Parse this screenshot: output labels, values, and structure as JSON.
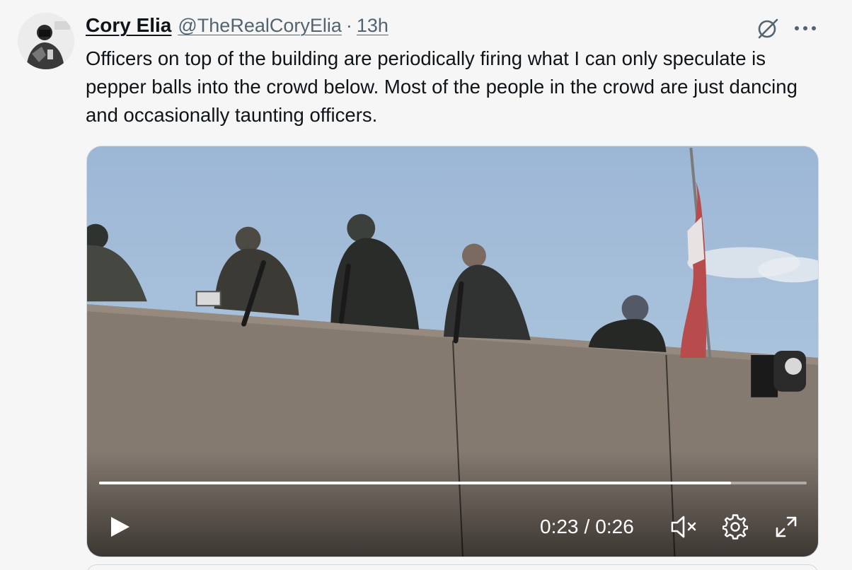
{
  "tweet": {
    "author_name": "Cory Elia",
    "handle": "@TheRealCoryElia",
    "separator": "·",
    "time": "13h",
    "text": "Officers on top of the building are periodically firing what I can only speculate is pepper balls into the crowd below. Most of the people in the crowd are just dancing and occasionally taunting officers.",
    "avatar_icon": "profile-photo"
  },
  "actions": {
    "grok_icon": "grok-icon",
    "more_icon": "more-horizontal-icon"
  },
  "video": {
    "current_time": "0:23",
    "time_separator": "/",
    "duration": "0:26",
    "progress_fraction": 0.893,
    "muted": true,
    "icons": [
      "play-icon",
      "mute-icon",
      "settings-icon",
      "fullscreen-icon"
    ]
  },
  "colors": {
    "text_primary": "#0f1419",
    "text_secondary": "#536471",
    "background": "#f6f6f6",
    "border": "#cfd9de"
  }
}
